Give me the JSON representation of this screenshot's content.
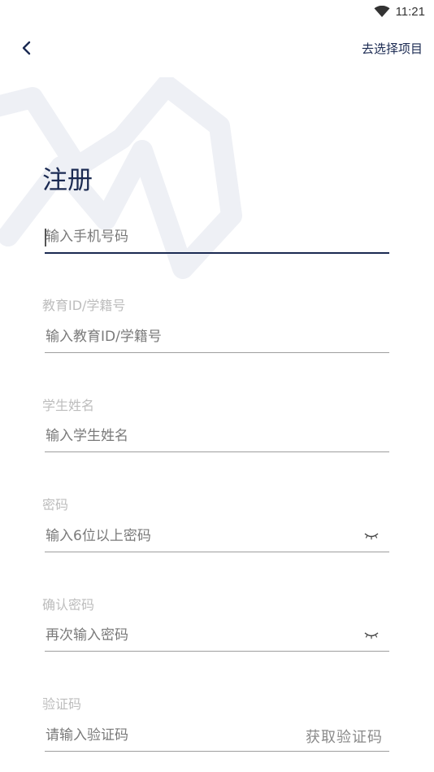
{
  "status_bar": {
    "time": "11:21",
    "wifi_icon": "wifi-icon"
  },
  "top_bar": {
    "back_icon": "chevron-left-icon",
    "choose_project": "去选择项目"
  },
  "title": "注册",
  "form": {
    "phone": {
      "placeholder": "输入手机号码",
      "value": ""
    },
    "edu_id": {
      "label": "教育ID/学籍号",
      "placeholder": "输入教育ID/学籍号",
      "value": ""
    },
    "student_name": {
      "label": "学生姓名",
      "placeholder": "输入学生姓名",
      "value": ""
    },
    "password": {
      "label": "密码",
      "placeholder": "输入6位以上密码",
      "value": "",
      "toggle_icon": "eye-closed-icon"
    },
    "confirm_password": {
      "label": "确认密码",
      "placeholder": "再次输入密码",
      "value": "",
      "toggle_icon": "eye-closed-icon"
    },
    "verify_code": {
      "label": "验证码",
      "placeholder": "请输入验证码",
      "value": "",
      "get_code": "获取验证码"
    }
  },
  "colors": {
    "primary": "#1b2a52",
    "label": "#bdbdbd",
    "underline": "#9e9e9e",
    "watermark": "#eef0f5"
  }
}
